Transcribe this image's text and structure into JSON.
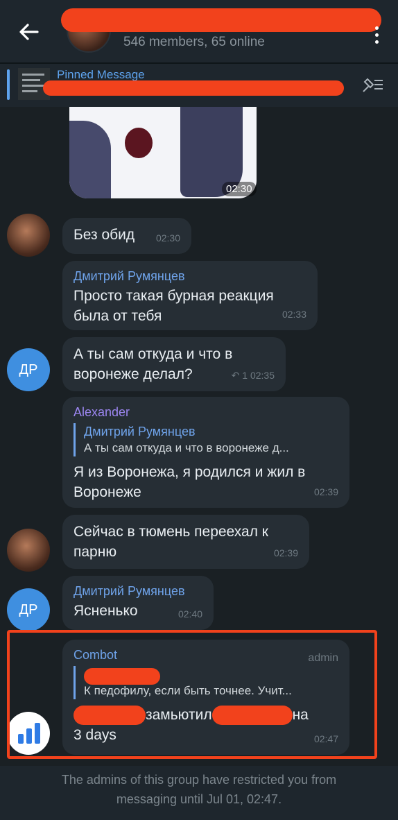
{
  "header": {
    "subtitle": "546 members, 65 online"
  },
  "pinned": {
    "title": "Pinned Message"
  },
  "messages": {
    "sticker_time": "02:30",
    "m1": {
      "text": "Без обид",
      "time": "02:30"
    },
    "m2": {
      "sender": "Дмитрий Румянцев",
      "text": "Просто такая бурная реакция была от тебя",
      "time": "02:33"
    },
    "m3": {
      "avatar_initials": "ДР",
      "text": "А ты сам откуда и что в воронеже делал?",
      "reply_count": "1",
      "time": "02:35"
    },
    "m4": {
      "sender": "Alexander",
      "quote_title": "Дмитрий Румянцев",
      "quote_text": "А ты сам откуда и что в воронеже д...",
      "text": "Я из Воронежа, я родился и жил в Воронеже",
      "time": "02:39"
    },
    "m5": {
      "text": "Сейчас в тюмень переехал к парню",
      "time": "02:39"
    },
    "m6": {
      "avatar_initials": "ДР",
      "sender": "Дмитрий Румянцев",
      "text": "Ясненько",
      "time": "02:40"
    },
    "m7": {
      "sender": "Combot",
      "admin_tag": "admin",
      "quote_text": "К педофилу, если быть точнее. Учит...",
      "text_mid": "замьютил",
      "text_end": "на",
      "text_line2": "3 days",
      "time": "02:47"
    }
  },
  "footer": {
    "restricted_line1": "The admins of this group have restricted you from",
    "restricted_line2": "messaging until Jul 01, 02:47."
  },
  "colors": {
    "accent": "#6fa3ea",
    "redaction": "#f2421c",
    "bubble": "#262e35",
    "background": "#1a2024"
  }
}
